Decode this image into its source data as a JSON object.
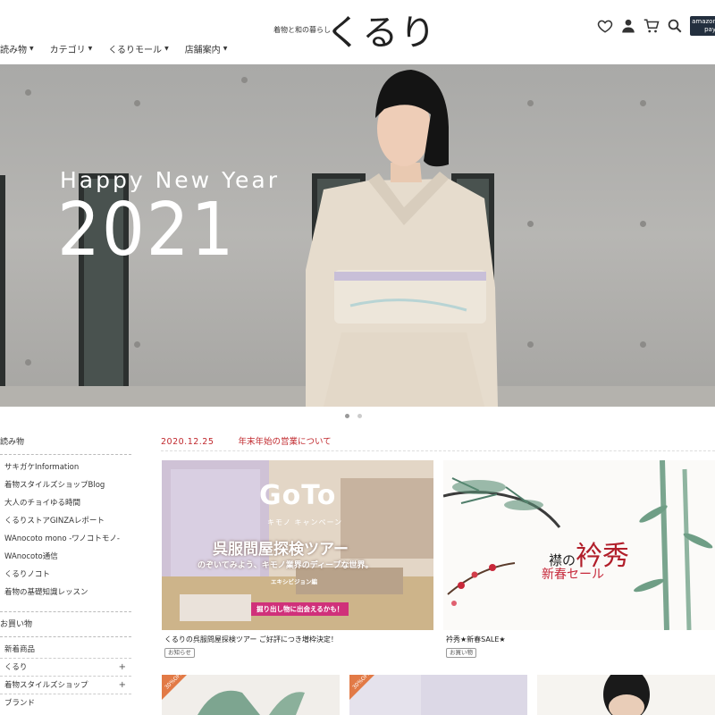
{
  "nav": {
    "items": [
      {
        "label": "読み物"
      },
      {
        "label": "カテゴリ"
      },
      {
        "label": "くるりモール"
      },
      {
        "label": "店舗案内"
      }
    ]
  },
  "logo": {
    "tagline": "着物と和の暮らし",
    "name": "くるり"
  },
  "header_icons": [
    "heart-icon",
    "user-icon",
    "cart-icon",
    "search-icon"
  ],
  "amazon_pay": {
    "line1": "amazon",
    "line2": "pay"
  },
  "hero": {
    "greeting": "Happy New Year",
    "year": "2021",
    "slides": 2,
    "active_slide": 0
  },
  "sidebar": {
    "reading_title": "読み物",
    "reading_items": [
      "サキガケInformation",
      "着物スタイルズショップBlog",
      "大人のチョイゆる時間",
      "くるりストアGINZAレポート",
      "WAnocoto mono -ワノコトモノ-",
      "WAnocoto通信",
      "くるりノコト",
      "着物の基礎知識レッスン"
    ],
    "shopping_title": "お買い物",
    "shopping_items": [
      {
        "label": "新着商品",
        "expand": ""
      },
      {
        "label": "くるり",
        "expand": "+"
      },
      {
        "label": "着物スタイルズショップ",
        "expand": "+"
      },
      {
        "label": "ブランド",
        "expand": ""
      }
    ]
  },
  "news": {
    "date": "2020.12.25",
    "title": "年末年始の営業について"
  },
  "cards": [
    {
      "title": "くるりの呉服問屋探検ツアー ご好評につき増枠決定！",
      "tag": "お知らせ",
      "goto": "GoTo",
      "goto_sub": "キモノ キャンペーン",
      "headline": "呉服問屋探検ツアー",
      "subline": "のぞいてみよう、キモノ業界のディープな世界。",
      "small": "エキシビジョン編",
      "badge": "掘り出し物に出会えるかも！"
    },
    {
      "title": "衿秀★新春SALE★",
      "tag": "お買い物",
      "sale_small": "襟の",
      "sale_big": "衿秀",
      "sale_sub": "新春セール"
    }
  ],
  "products": [
    {
      "badge": "30%OFF"
    },
    {
      "badge": "30%OFF"
    },
    {
      "badge": ""
    }
  ],
  "colors": {
    "accent": "#c0282d",
    "amazon": "#232f3e",
    "badge": "#e27a46"
  }
}
